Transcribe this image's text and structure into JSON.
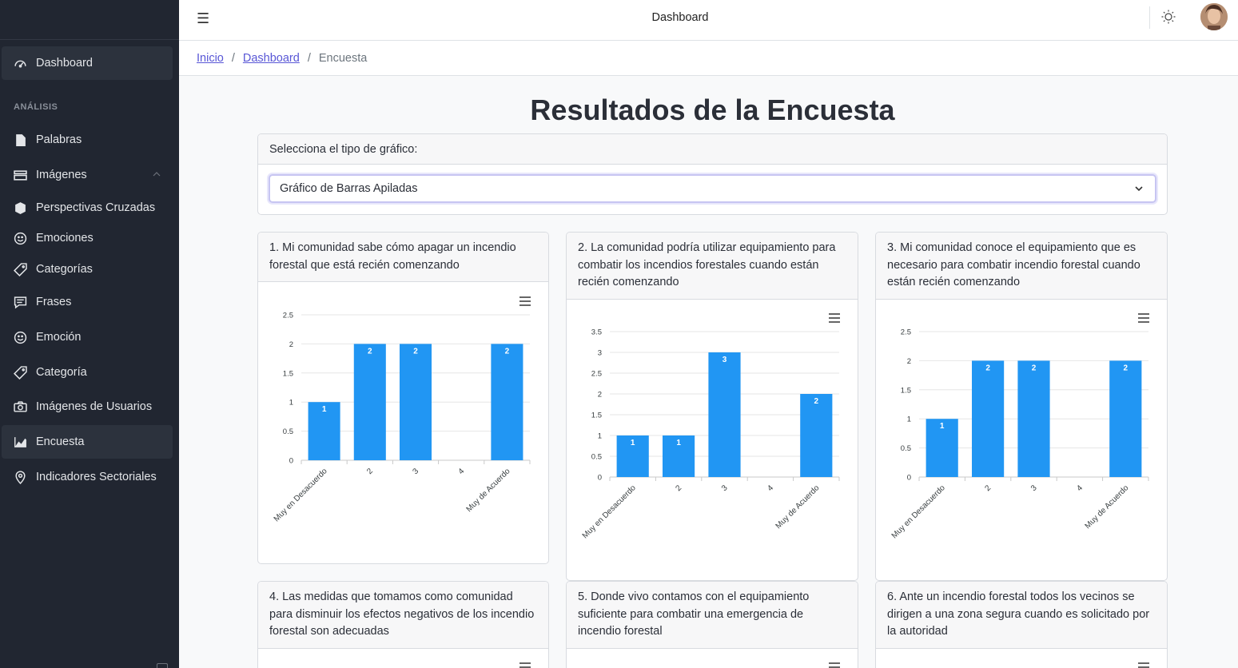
{
  "header": {
    "title": "Dashboard"
  },
  "breadcrumb": {
    "home": "Inicio",
    "dashboard": "Dashboard",
    "current": "Encuesta"
  },
  "sidebar": {
    "section_title": "ANÁLISIS",
    "items": [
      {
        "label": "Dashboard",
        "icon": "speedometer-icon"
      },
      {
        "label": "Palabras",
        "icon": "document-icon"
      },
      {
        "label": "Imágenes",
        "icon": "layers-icon"
      },
      {
        "label": "Perspectivas Cruzadas",
        "icon": "cube-icon"
      },
      {
        "label": "Emociones",
        "icon": "smile-icon"
      },
      {
        "label": "Categorías",
        "icon": "tag-icon"
      },
      {
        "label": "Frases",
        "icon": "speech-bubble-icon"
      },
      {
        "label": "Emoción",
        "icon": "smile-icon"
      },
      {
        "label": "Categoría",
        "icon": "tag-icon"
      },
      {
        "label": "Imágenes de Usuarios",
        "icon": "camera-icon"
      },
      {
        "label": "Encuesta",
        "icon": "area-chart-icon"
      },
      {
        "label": "Indicadores Sectoriales",
        "icon": "location-pin-icon"
      }
    ]
  },
  "main": {
    "title": "Resultados de la Encuesta",
    "chart_type_label": "Selecciona el tipo de gráfico:",
    "chart_type_value": "Gráfico de Barras Apiladas"
  },
  "questions": [
    "1. Mi comunidad sabe cómo apagar un incendio forestal que está recién comenzando",
    "2. La comunidad podría utilizar equipamiento para combatir los incendios forestales cuando están recién comenzando",
    "3. Mi comunidad conoce el equipamiento que es necesario para combatir incendio forestal cuando están recién comenzando",
    "4. Las medidas que tomamos como comunidad para disminuir los efectos negativos de los incendio forestal son adecuadas",
    "5. Donde vivo contamos con el equipamiento suficiente para combatir una emergencia de incendio forestal",
    "6. Ante un incendio forestal todos los vecinos se dirigen a una zona segura cuando es solicitado por la autoridad"
  ],
  "chart_data": [
    {
      "type": "bar",
      "categories": [
        "Muy en Desacuerdo",
        "2",
        "3",
        "4",
        "Muy de Acuerdo"
      ],
      "values": [
        1,
        2,
        2,
        0,
        2
      ],
      "ylim": [
        0,
        2.5
      ],
      "yticks": [
        "0",
        "0.5",
        "1",
        "1.5",
        "2",
        "2.5"
      ],
      "grid": true,
      "color": "#2196f3"
    },
    {
      "type": "bar",
      "categories": [
        "Muy en Desacuerdo",
        "2",
        "3",
        "4",
        "Muy de Acuerdo"
      ],
      "values": [
        1,
        1,
        3,
        0,
        2
      ],
      "ylim": [
        0,
        3.5
      ],
      "yticks": [
        "0",
        "0.5",
        "1",
        "1.5",
        "2",
        "2.5",
        "3",
        "3.5"
      ],
      "grid": true,
      "color": "#2196f3"
    },
    {
      "type": "bar",
      "categories": [
        "Muy en Desacuerdo",
        "2",
        "3",
        "4",
        "Muy de Acuerdo"
      ],
      "values": [
        1,
        2,
        2,
        0,
        2
      ],
      "ylim": [
        0,
        2.5
      ],
      "yticks": [
        "0",
        "0.5",
        "1",
        "1.5",
        "2",
        "2.5"
      ],
      "grid": true,
      "color": "#2196f3"
    }
  ]
}
